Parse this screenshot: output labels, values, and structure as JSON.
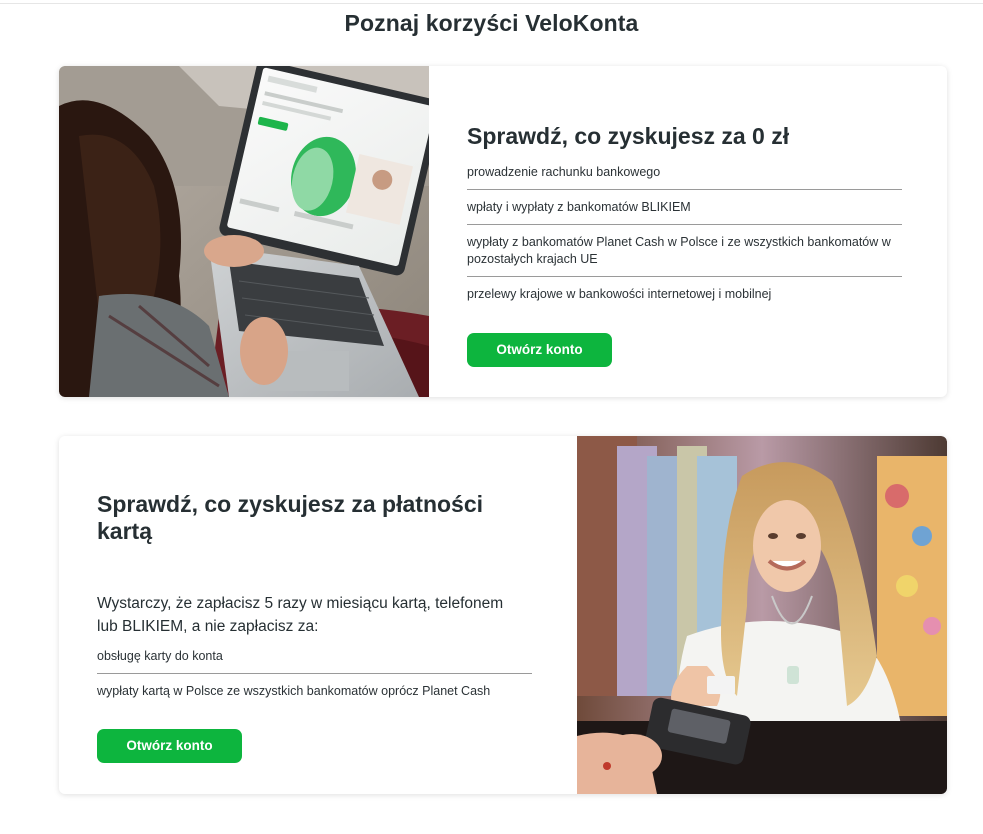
{
  "page": {
    "title": "Poznaj korzyści VeloKonta"
  },
  "section1": {
    "heading": "Sprawdź, co zyskujesz za 0 zł",
    "items": [
      "prowadzenie rachunku bankowego",
      "wpłaty i wypłaty z bankomatów BLIKIEM",
      "wypłaty z bankomatów Planet Cash w Polsce i ze wszystkich bankomatów w pozostałych krajach UE",
      "przelewy krajowe w bankowości internetowej i mobilnej"
    ],
    "button_label": "Otwórz konto",
    "image_icon": "woman-laptop-photo"
  },
  "section2": {
    "heading": "Sprawdź, co zyskujesz za płatności kartą",
    "lead": "Wystarczy, że zapłacisz 5 razy w miesiącu kartą, telefonem lub BLIKIEM, a nie zapłacisz za:",
    "items": [
      "obsługę karty do konta",
      "wypłaty kartą w Polsce ze wszystkich bankomatów oprócz Planet Cash"
    ],
    "button_label": "Otwórz konto",
    "image_icon": "woman-card-terminal-photo"
  },
  "colors": {
    "accent": "#0db53e",
    "text": "#262f33",
    "divider": "#9a9a9a"
  }
}
